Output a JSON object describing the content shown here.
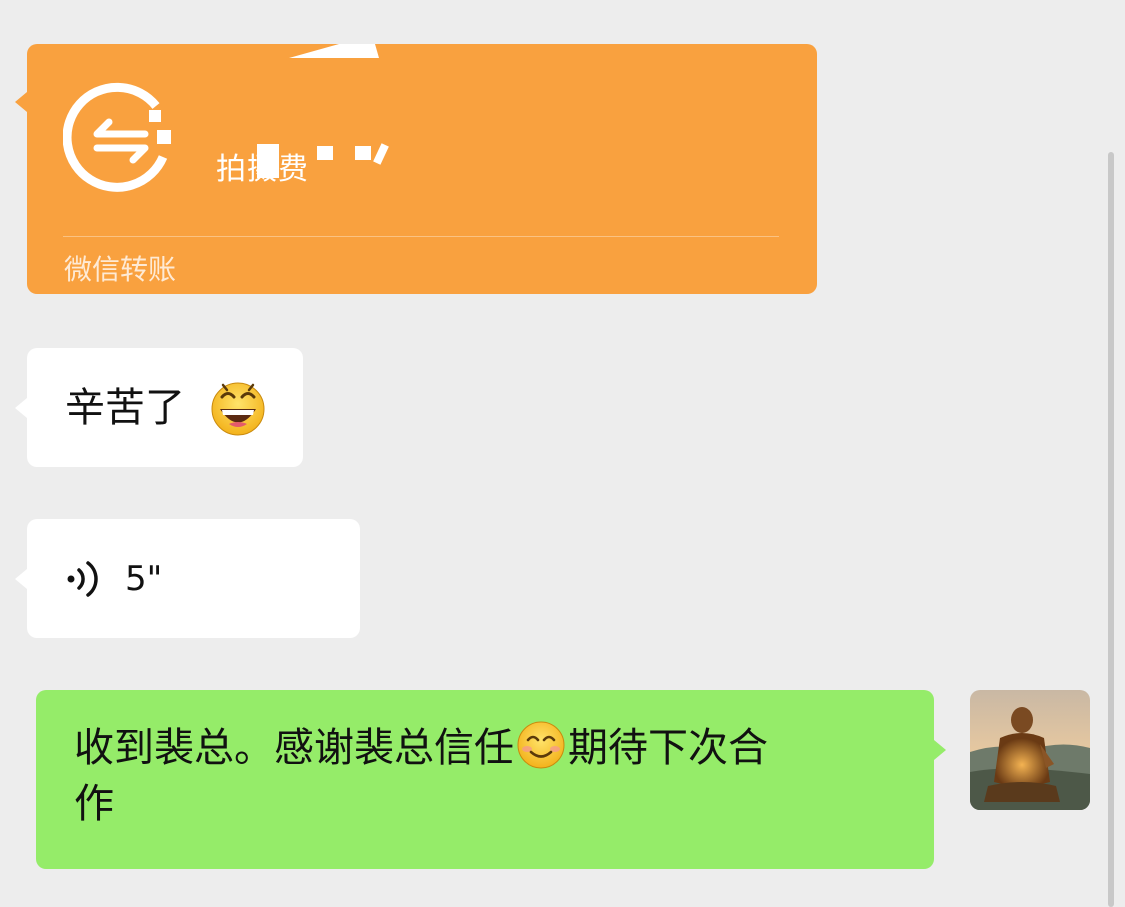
{
  "colors": {
    "background": "#ededed",
    "transfer_card": "#f9a13f",
    "incoming_bubble": "#ffffff",
    "outgoing_bubble": "#95ec69"
  },
  "transfer": {
    "icon": "transfer-arrows-icon",
    "memo": "拍摄费",
    "footer_label": "微信转账"
  },
  "messages": [
    {
      "direction": "incoming",
      "type": "text",
      "text": "辛苦了",
      "emoji": "grinning-face-icon"
    },
    {
      "direction": "incoming",
      "type": "voice",
      "icon": "voice-wave-icon",
      "duration": "5\""
    },
    {
      "direction": "outgoing",
      "type": "text",
      "line1_part1": "收到裴总。感谢裴总信任",
      "emoji": "smiling-face-icon",
      "line1_part2": "期待下次合",
      "line2": "作"
    }
  ],
  "avatar": {
    "icon": "buddha-statue-avatar"
  }
}
